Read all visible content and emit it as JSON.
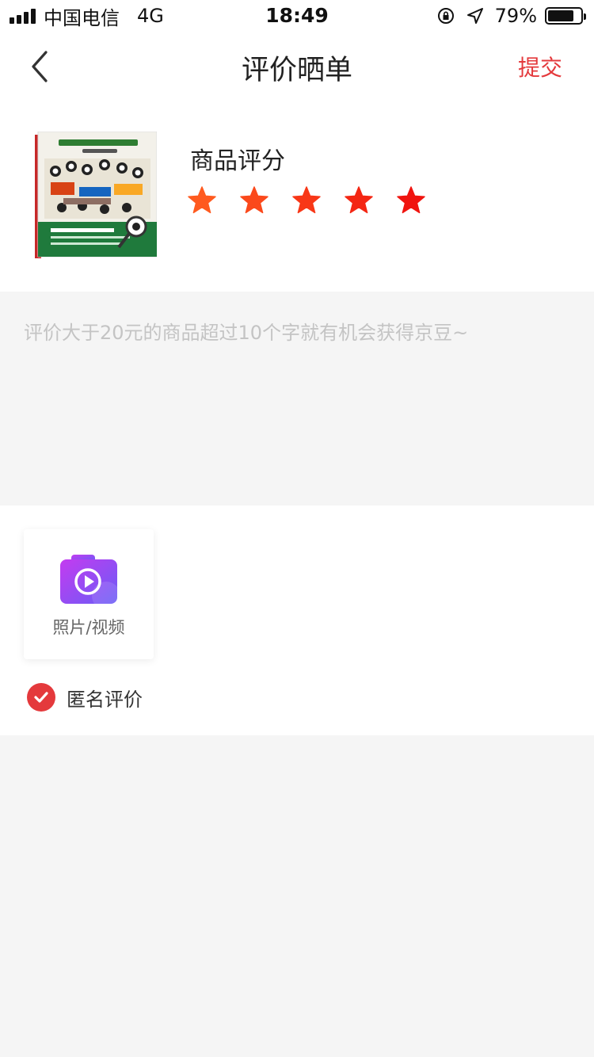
{
  "status_bar": {
    "carrier": "中国电信",
    "network": "4G",
    "time": "18:49",
    "battery": "79%",
    "battery_level": 0.79
  },
  "nav": {
    "title": "评价晒单",
    "submit_label": "提交",
    "back_icon": "chevron-left-icon"
  },
  "product": {
    "rating_label": "商品评分",
    "rating": 5,
    "max_rating": 5
  },
  "comment": {
    "placeholder": "评价大于20元的商品超过10个字就有机会获得京豆~"
  },
  "media": {
    "upload_label": "照片/视频",
    "anonymous_label": "匿名评价",
    "anonymous_checked": true
  },
  "colors": {
    "accent": "#e4393c",
    "star_start": "#ff5a1f",
    "star_end": "#f0140f",
    "camera_start": "#c43bf0",
    "camera_end": "#6a5cf6"
  }
}
